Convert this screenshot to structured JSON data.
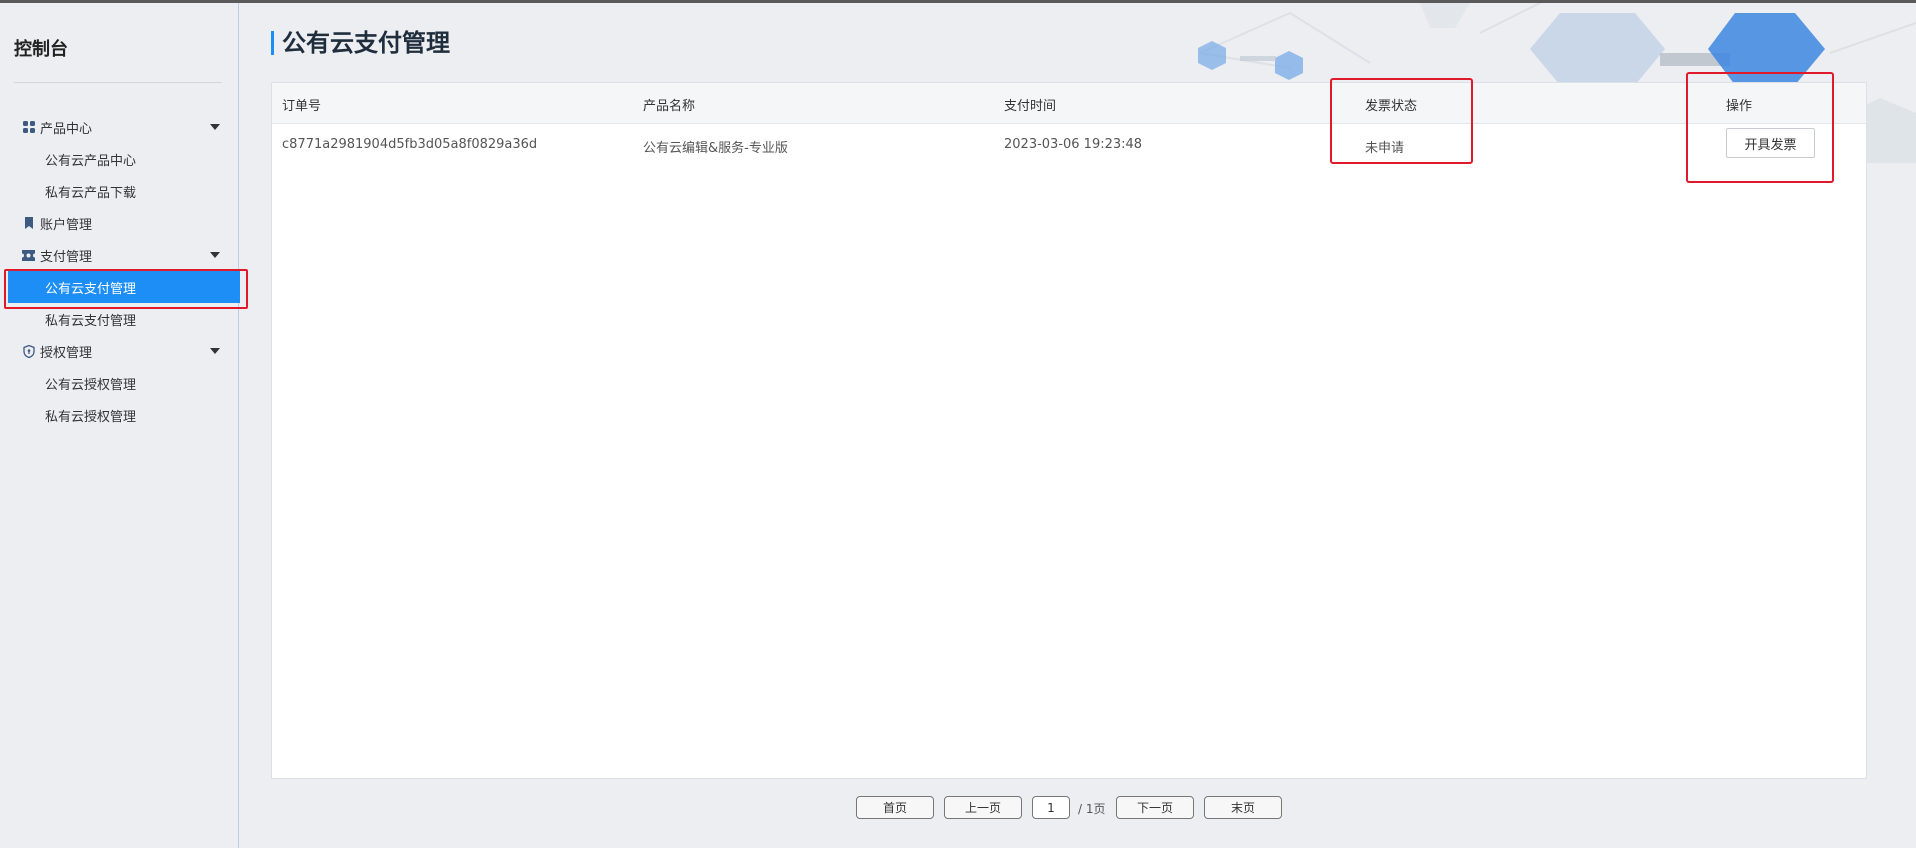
{
  "sidebar": {
    "title": "控制台",
    "groups": [
      {
        "label": "产品中心",
        "icon": "grid-icon",
        "items": [
          "公有云产品中心",
          "私有云产品下载"
        ]
      },
      {
        "label": "账户管理",
        "icon": "bookmark-icon",
        "items": []
      },
      {
        "label": "支付管理",
        "icon": "ticket-icon",
        "items": [
          "公有云支付管理",
          "私有云支付管理"
        ]
      },
      {
        "label": "授权管理",
        "icon": "shield-icon",
        "items": [
          "公有云授权管理",
          "私有云授权管理"
        ]
      }
    ],
    "active_item": "公有云支付管理"
  },
  "main": {
    "title": "公有云支付管理",
    "table": {
      "columns": [
        "订单号",
        "产品名称",
        "支付时间",
        "发票状态",
        "操作"
      ],
      "rows": [
        {
          "order_id": "c8771a2981904d5fb3d05a8f0829a36d",
          "product": "公有云编辑&服务-专业版",
          "pay_time": "2023-03-06 19:23:48",
          "invoice_status": "未申请",
          "action_label": "开具发票"
        }
      ]
    }
  },
  "pagination": {
    "first": "首页",
    "prev": "上一页",
    "current": "1",
    "total": "/ 1页",
    "next": "下一页",
    "last": "末页"
  },
  "colors": {
    "accent": "#1c8ef5",
    "highlight": "#e0192b",
    "sidebar_bg": "#eceef2"
  }
}
